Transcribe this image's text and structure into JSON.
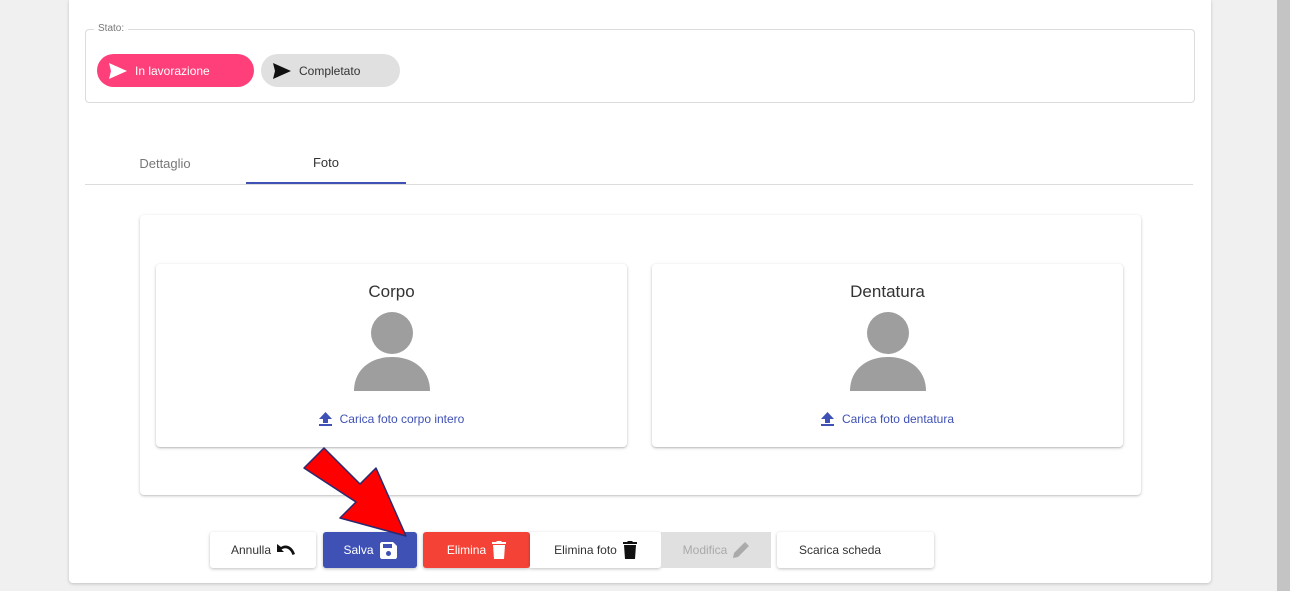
{
  "stato": {
    "legend": "Stato:",
    "chips": [
      {
        "label": "In lavorazione",
        "active": true
      },
      {
        "label": "Completato",
        "active": false
      }
    ]
  },
  "tabs": [
    {
      "label": "Dettaglio",
      "active": false
    },
    {
      "label": "Foto",
      "active": true
    }
  ],
  "photos": {
    "left": {
      "title": "Corpo",
      "upload_label": "Carica foto corpo intero"
    },
    "right": {
      "title": "Dentatura",
      "upload_label": "Carica foto dentatura"
    }
  },
  "buttons": {
    "annulla": "Annulla",
    "salva": "Salva",
    "elimina": "Elimina",
    "elimina_foto": "Elimina foto",
    "modifica": "Modifica",
    "scarica": "Scarica scheda"
  },
  "colors": {
    "accent": "#3f51b5",
    "chip_active": "#ff3f7a",
    "danger": "#f44336",
    "avatar": "#9e9e9e",
    "annotation_arrow": "#ff0000"
  },
  "icons": {
    "chip": "send-icon",
    "upload": "upload-icon",
    "annulla": "undo-icon",
    "salva": "save-icon",
    "elimina": "trash-icon",
    "modifica": "pencil-icon"
  }
}
